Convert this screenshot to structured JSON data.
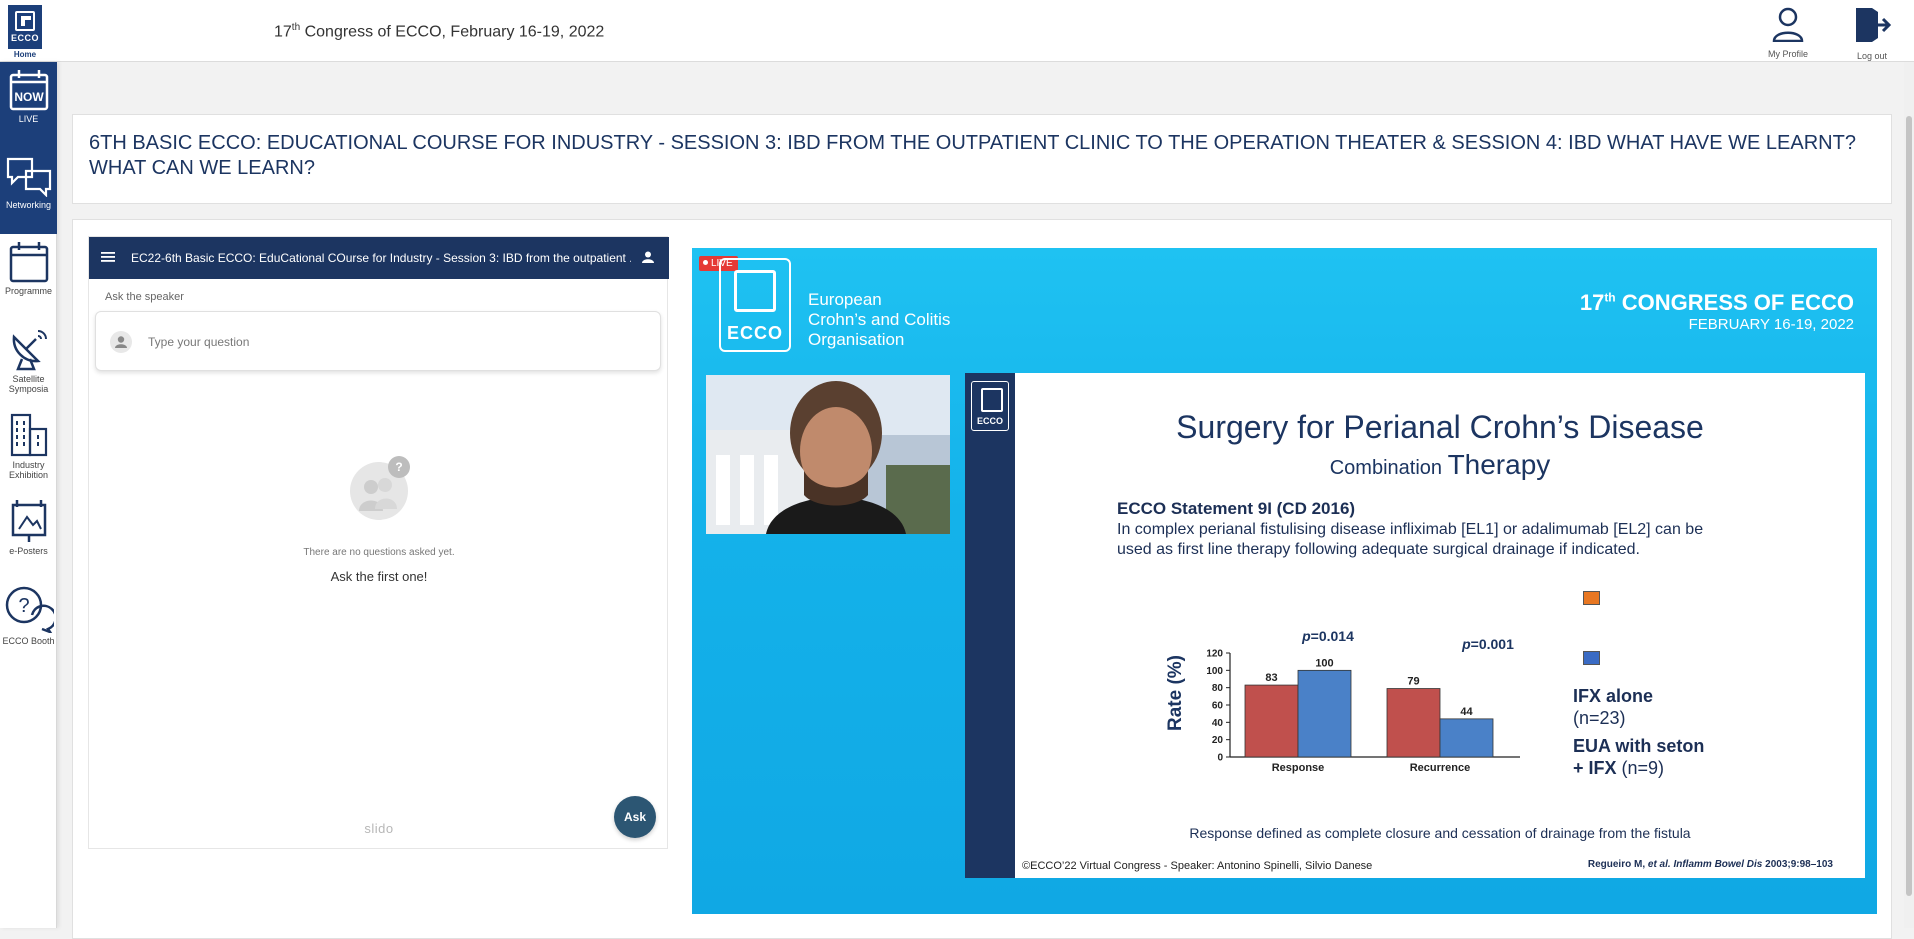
{
  "header": {
    "home_logo_text": "ECCO",
    "home_label": "Home",
    "congress_ordinal": "17",
    "congress_sup": "th",
    "congress_rest": " Congress of ECCO, February 16-19, 2022",
    "profile_label": "My Profile",
    "logout_label": "Log out"
  },
  "sidebar": {
    "items": [
      {
        "label": "LIVE",
        "icon": "now-icon",
        "icon_text": "NOW"
      },
      {
        "label": "Networking",
        "icon": "chat-bubbles-icon"
      },
      {
        "label": "Programme",
        "icon": "calendar-icon"
      },
      {
        "label": "Satellite Symposia",
        "icon": "satellite-dish-icon"
      },
      {
        "label": "Industry Exhibition",
        "icon": "buildings-icon"
      },
      {
        "label": "e-Posters",
        "icon": "poster-icon"
      },
      {
        "label": "ECCO Booth",
        "icon": "help-bubble-icon"
      }
    ]
  },
  "session": {
    "title": "6TH BASIC ECCO: EDUCATIONAL COURSE FOR INDUSTRY - SESSION 3: IBD FROM THE OUTPATIENT CLINIC TO THE OPERATION THEATER & SESSION 4: IBD WHAT HAVE WE LEARNT? WHAT CAN WE LEARN?"
  },
  "slido": {
    "header_title": "EC22-6th Basic ECCO: EduCational COurse for Industry - Session 3: IBD from the outpatient ...",
    "ask_label": "Ask the speaker",
    "question_placeholder": "Type your question",
    "no_questions": "There are no questions asked yet.",
    "ask_first": "Ask the first one!",
    "brand": "slido",
    "ask_button": "Ask"
  },
  "video": {
    "live_label": "LIVE",
    "org_logo_text": "ECCO",
    "org_name_lines": [
      "European",
      "Crohn’s and Colitis",
      "Organisation"
    ],
    "congress_ordinal": "17",
    "congress_sup": "th",
    "congress_rest": " CONGRESS OF ECCO",
    "congress_dates": "FEBRUARY 16-19, 2022",
    "slide": {
      "logo_text": "ECCO",
      "title": "Surgery for Perianal Crohn’s Disease",
      "subtitle_small": "Combination ",
      "subtitle_big": "Therapy",
      "statement_head": "ECCO Statement 9I (CD 2016)",
      "statement_body": "In complex perianal fistulising disease infliximab [EL1] or adalimumab [EL2] can be used as first line therapy following adequate surgical drainage if indicated.",
      "legend_1_bold": "IFX alone",
      "legend_1_rest": "(n=23)",
      "legend_2_bold_a": "EUA with seton",
      "legend_2_bold_b": "+ IFX",
      "legend_2_rest": " (n=9)",
      "response_note": "Response defined as complete closure and cessation of drainage from the fistula",
      "footer_left": "©ECCO’22 Virtual Congress -  Speaker: Antonino Spinelli, Silvio Danese",
      "footer_ref_a": "Regueiro M, ",
      "footer_ref_italic": "et al. Inflamm Bowel Dis",
      "footer_ref_b": " 2003;9:98–103"
    }
  },
  "chart_data": {
    "type": "bar",
    "categories": [
      "Response",
      "Recurrence"
    ],
    "series": [
      {
        "name": "IFX alone",
        "values": [
          83,
          79
        ],
        "color": "#c0504d"
      },
      {
        "name": "EUA with seton + IFX",
        "values": [
          100,
          44
        ],
        "color": "#4a81c8"
      }
    ],
    "ylabel": "Rate (%)",
    "ylim": [
      0,
      120
    ],
    "yticks": [
      0,
      20,
      40,
      60,
      80,
      100,
      120
    ],
    "annotations": [
      "p=0.014",
      "p=0.001"
    ]
  },
  "colors": {
    "navy": "#1c3561",
    "sidebar_active": "#1c3f7a",
    "live_red": "#e53935",
    "video_blue": "#14b2ea"
  }
}
